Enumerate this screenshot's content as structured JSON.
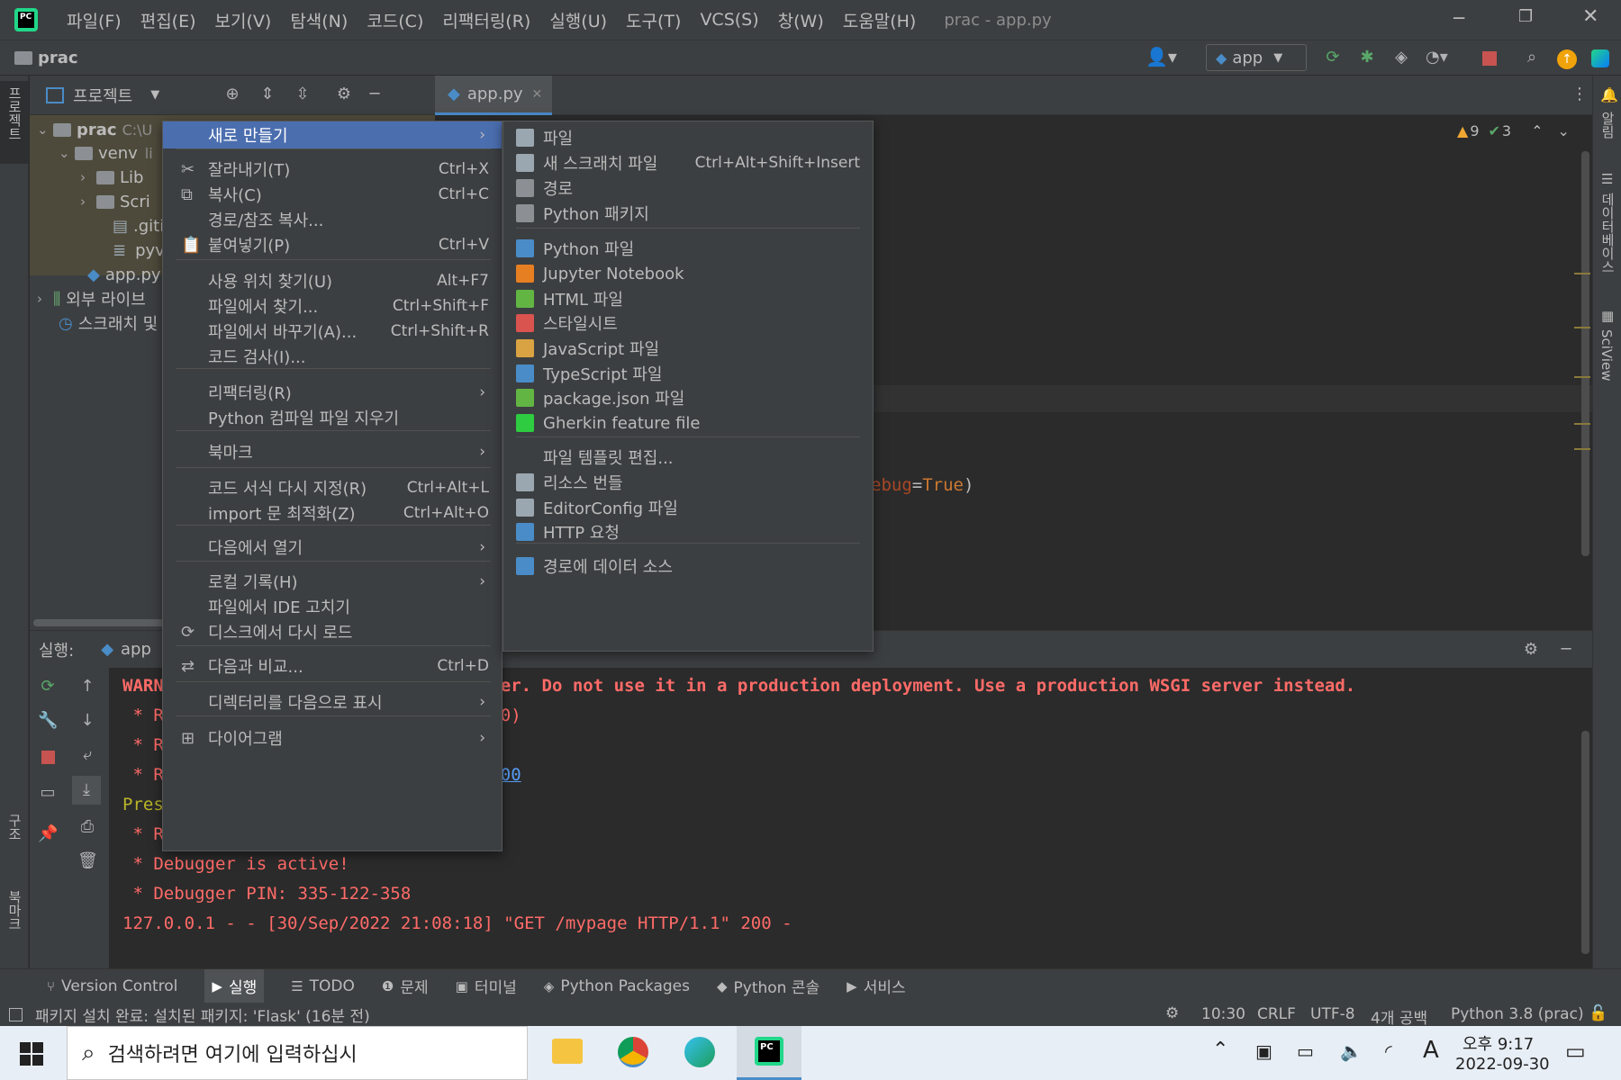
{
  "title_bar": {
    "logo_text": "PC",
    "menus": [
      "파일(F)",
      "편집(E)",
      "보기(V)",
      "탐색(N)",
      "코드(C)",
      "리팩터링(R)",
      "실행(U)",
      "도구(T)",
      "VCS(S)",
      "창(W)",
      "도움말(H)"
    ],
    "window_title": "prac - app.py"
  },
  "nav_bar": {
    "project_name": "prac",
    "run_config": "app"
  },
  "left_strip": {
    "project_tab": "프로젝트",
    "structure_tab": "구조",
    "bookmarks_tab": "북마크"
  },
  "right_strip": {
    "notifications_tab": "알림",
    "database_tab": "데이터베이스",
    "sciview_tab": "SciView"
  },
  "project_panel": {
    "header_label": "프로젝트",
    "tree": [
      {
        "label": "prac",
        "path": "C:\\U"
      },
      {
        "label": "venv",
        "suffix": "li"
      },
      {
        "label": "Lib"
      },
      {
        "label": "Scri"
      },
      {
        "label": ".giti"
      },
      {
        "label": "pyv"
      },
      {
        "label": "app.py"
      },
      {
        "label": "외부 라이브"
      },
      {
        "label": "스크래치 및"
      }
    ]
  },
  "editor": {
    "tab_label": "app.py",
    "warnings": "9",
    "checks": "3",
    "code_fragment_key": "ebug",
    "code_fragment_value": "True",
    "code_fragment_close": ")"
  },
  "run_panel": {
    "label": "실행:",
    "config": "app"
  },
  "console": {
    "lines": [
      {
        "pre": "WARN",
        "post": "er. Do not use it in a production deployment. Use a production WSGI server instead."
      },
      {
        "pre": " * R",
        "post": "0)"
      },
      {
        "pre": " * R",
        "post": ""
      },
      {
        "pre": " * R",
        "post": "00"
      },
      {
        "pre": "Pres",
        "post": ""
      },
      {
        "pre": " * R",
        "post": ""
      },
      {
        "pre": " * Debugger is active!",
        "post": ""
      },
      {
        "pre": " * Debugger PIN: 335-122-358",
        "post": ""
      },
      {
        "pre": "127.0.0.1 - - [30/Sep/2022 21:08:18] \"GET /mypage HTTP/1.1\" 200 -",
        "post": ""
      }
    ]
  },
  "context_menu": {
    "items": [
      {
        "label": "새로 만들기",
        "submenu": true,
        "selected": true
      },
      {
        "label": "잘라내기(T)",
        "shortcut": "Ctrl+X",
        "icon": "✂"
      },
      {
        "label": "복사(C)",
        "shortcut": "Ctrl+C",
        "icon": "⧉"
      },
      {
        "label": "경로/참조 복사..."
      },
      {
        "label": "붙여넣기(P)",
        "shortcut": "Ctrl+V",
        "icon": "📋"
      },
      {
        "label": "사용 위치 찾기(U)",
        "shortcut": "Alt+F7"
      },
      {
        "label": "파일에서 찾기...",
        "shortcut": "Ctrl+Shift+F"
      },
      {
        "label": "파일에서 바꾸기(A)...",
        "shortcut": "Ctrl+Shift+R"
      },
      {
        "label": "코드 검사(I)..."
      },
      {
        "label": "리팩터링(R)",
        "submenu": true
      },
      {
        "label": "Python 컴파일 파일 지우기"
      },
      {
        "label": "북마크",
        "submenu": true
      },
      {
        "label": "코드 서식 다시 지정(R)",
        "shortcut": "Ctrl+Alt+L"
      },
      {
        "label": "import 문 최적화(Z)",
        "shortcut": "Ctrl+Alt+O"
      },
      {
        "label": "다음에서 열기",
        "submenu": true
      },
      {
        "label": "로컬 기록(H)",
        "submenu": true
      },
      {
        "label": "파일에서 IDE 고치기"
      },
      {
        "label": "디스크에서 다시 로드",
        "icon": "⟳"
      },
      {
        "label": "다음과 비교...",
        "shortcut": "Ctrl+D",
        "icon": "⇄"
      },
      {
        "label": "디렉터리를 다음으로 표시",
        "submenu": true
      },
      {
        "label": "다이어그램",
        "submenu": true,
        "icon": "⊞"
      }
    ]
  },
  "new_submenu": {
    "items": [
      {
        "label": "파일",
        "icon_color": "#9aa7b0"
      },
      {
        "label": "새 스크래치 파일",
        "shortcut": "Ctrl+Alt+Shift+Insert",
        "icon_color": "#9aa7b0"
      },
      {
        "label": "경로",
        "icon_color": "#8c9094"
      },
      {
        "label": "Python 패키지",
        "icon_color": "#8c9094"
      },
      {
        "label": "Python 파일",
        "icon_color": "#4a8cc7"
      },
      {
        "label": "Jupyter Notebook",
        "icon_color": "#e67e22"
      },
      {
        "label": "HTML 파일",
        "icon_color": "#62b543"
      },
      {
        "label": "스타일시트",
        "icon_color": "#d9534f"
      },
      {
        "label": "JavaScript 파일",
        "icon_color": "#d9a343"
      },
      {
        "label": "TypeScript 파일",
        "icon_color": "#4a8cc7"
      },
      {
        "label": "package.json 파일",
        "icon_color": "#62b543"
      },
      {
        "label": "Gherkin feature file",
        "icon_color": "#2ecc40"
      },
      {
        "label": "파일 템플릿 편집...",
        "icon_color": ""
      },
      {
        "label": "리소스 번들",
        "icon_color": "#9aa7b0"
      },
      {
        "label": "EditorConfig 파일",
        "icon_color": "#9aa7b0"
      },
      {
        "label": "HTTP 요청",
        "icon_color": "#4a8cc7"
      },
      {
        "label": "경로에 데이터 소스",
        "icon_color": "#4a8cc7"
      }
    ]
  },
  "bottom_tabs": [
    "Version Control",
    "실행",
    "TODO",
    "문제",
    "터미널",
    "Python Packages",
    "Python 콘솔",
    "서비스"
  ],
  "status_bar": {
    "message": "패키지 설치 완료: 설치된 패키지: 'Flask' (16분 전)",
    "line_col": "10:30",
    "line_sep": "CRLF",
    "encoding": "UTF-8",
    "indent": "4개 공백",
    "interpreter": "Python 3.8 (prac)"
  },
  "taskbar": {
    "search_placeholder": "검색하려면 여기에 입력하십시",
    "time": "오후 9:17",
    "date": "2022-09-30",
    "ime": "A"
  },
  "colors": {
    "accent": "#4b6eaf",
    "console_text": "#ff6b68",
    "code_value": "#cc7832"
  }
}
